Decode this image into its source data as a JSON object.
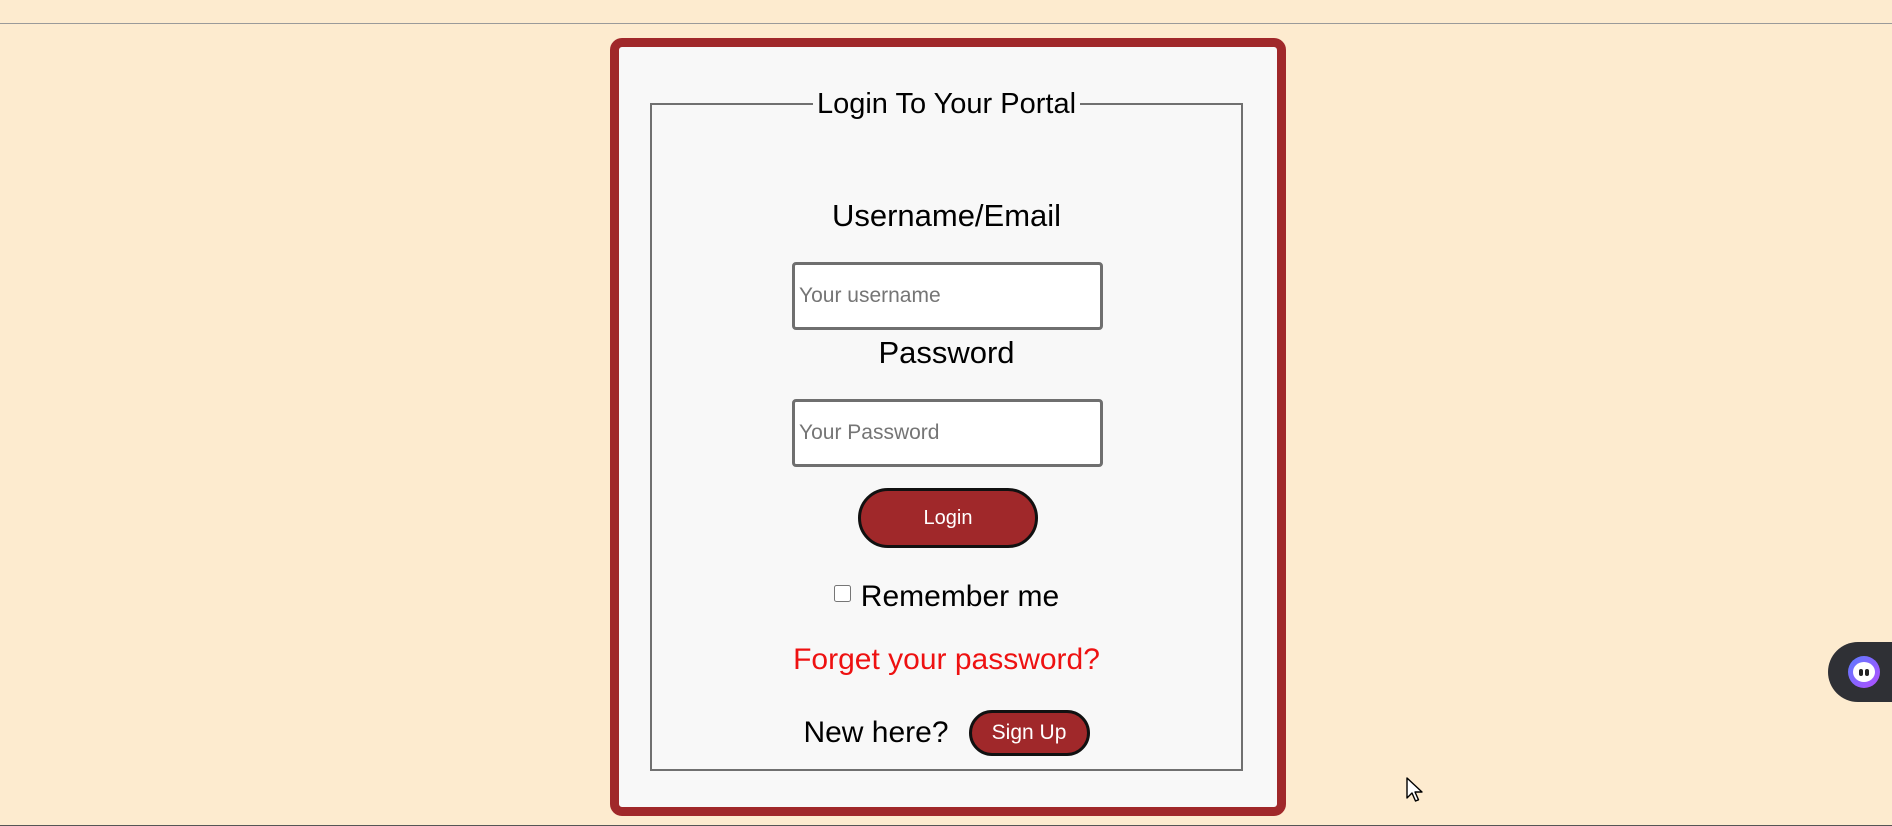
{
  "form": {
    "title": "Login To Your Portal",
    "username_label": "Username/Email",
    "username_placeholder": "Your username",
    "password_label": "Password",
    "password_placeholder": "Your Password",
    "login_label": "Login",
    "remember_label": "Remember me",
    "remember_checked": false,
    "forgot_label": "Forget your password?",
    "new_here_label": "New here?",
    "signup_label": "Sign Up"
  },
  "colors": {
    "page_background": "#fdebcf",
    "card_border": "#a0282a",
    "button_fill": "#a0282a",
    "link": "#ee1111"
  },
  "widgets": {
    "assistant_icon": "assistant-face-icon",
    "cursor_icon": "mouse-pointer-icon"
  }
}
